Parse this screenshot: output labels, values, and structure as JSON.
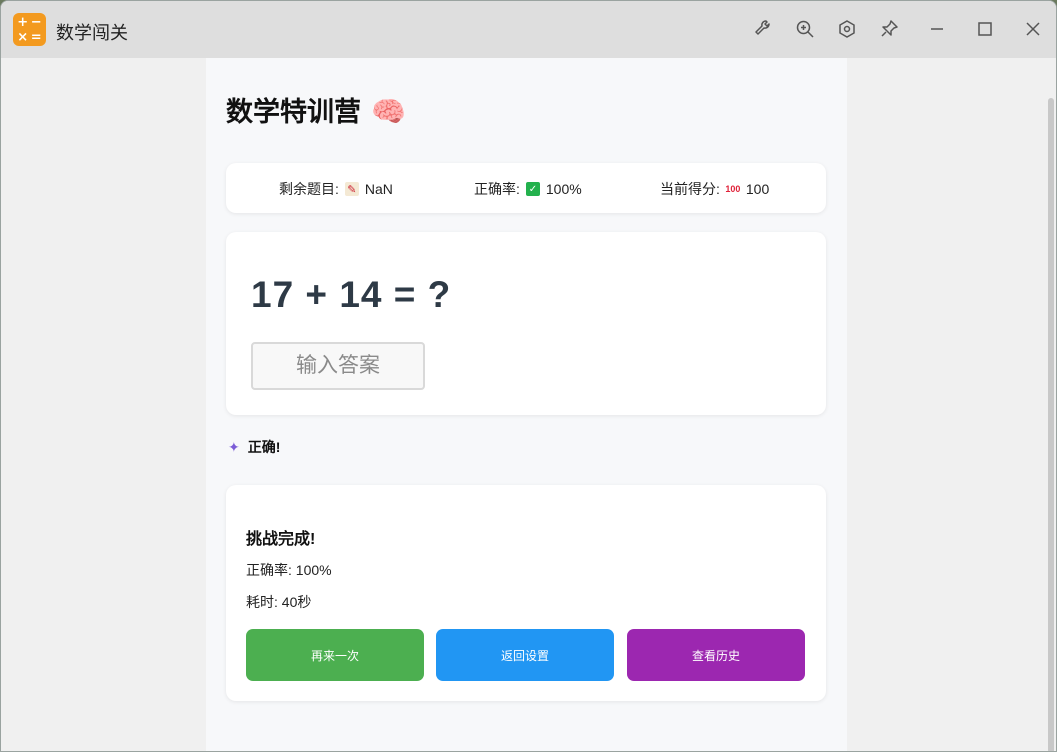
{
  "window": {
    "title": "数学闯关",
    "app_icon_glyphs": [
      "+",
      "−",
      "×",
      "="
    ],
    "toolbar_icons": [
      "wrench-icon",
      "zoom-in-icon",
      "hexagon-settings-icon",
      "pin-icon",
      "minimize-icon",
      "maximize-icon",
      "close-icon"
    ]
  },
  "page": {
    "title": "数学特训营",
    "title_emoji": "🧠"
  },
  "stats": {
    "remaining_label": "剩余题目:",
    "remaining_value": "NaN",
    "accuracy_label": "正确率:",
    "accuracy_value": "100%",
    "score_label": "当前得分:",
    "score_value": "100"
  },
  "question": {
    "text": "17 + 14 = ?",
    "input_placeholder": "输入答案",
    "input_value": ""
  },
  "feedback": {
    "text": "正确!"
  },
  "result": {
    "title": "挑战完成!",
    "accuracy_line": "正确率: 100%",
    "time_line": "耗时: 40秒",
    "buttons": {
      "retry": "再来一次",
      "back": "返回设置",
      "history": "查看历史"
    }
  },
  "colors": {
    "retry": "#4caf50",
    "back": "#2196f3",
    "history": "#9c27b0",
    "app_icon": "#f39a1f"
  }
}
